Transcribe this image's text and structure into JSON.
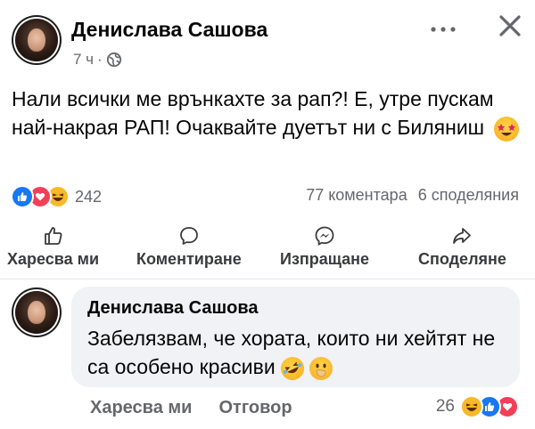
{
  "post": {
    "author": "Денислава Сашова",
    "time": "7 ч",
    "separator": "·",
    "text": "Нали всички ме врънкахте за рап?! Е, утре пускам най-накрая РАП! Очаквайте дуетът ни с Биляниш",
    "text_emoji": "star-struck-emoji",
    "reaction_count": "242",
    "comments": "77 коментара",
    "shares": "6 споделяния"
  },
  "actions": {
    "like": "Харесва ми",
    "comment": "Коментиране",
    "send": "Изпращане",
    "share": "Споделяне"
  },
  "comment": {
    "author": "Денислава Сашова",
    "text": "Забелязвам, че хората, които ни хейтят не са особено красиви",
    "like": "Харесва ми",
    "reply": "Отговор",
    "reaction_count": "26"
  },
  "colors": {
    "like_blue": "#1877f2",
    "love_red": "#f33e58",
    "haha_yellow": "#f7b928",
    "meta_gray": "#65676b",
    "bubble_bg": "#f0f2f5"
  },
  "icons": [
    "more-icon",
    "close-icon",
    "globe-icon",
    "like-icon",
    "comment-icon",
    "messenger-icon",
    "share-icon"
  ]
}
